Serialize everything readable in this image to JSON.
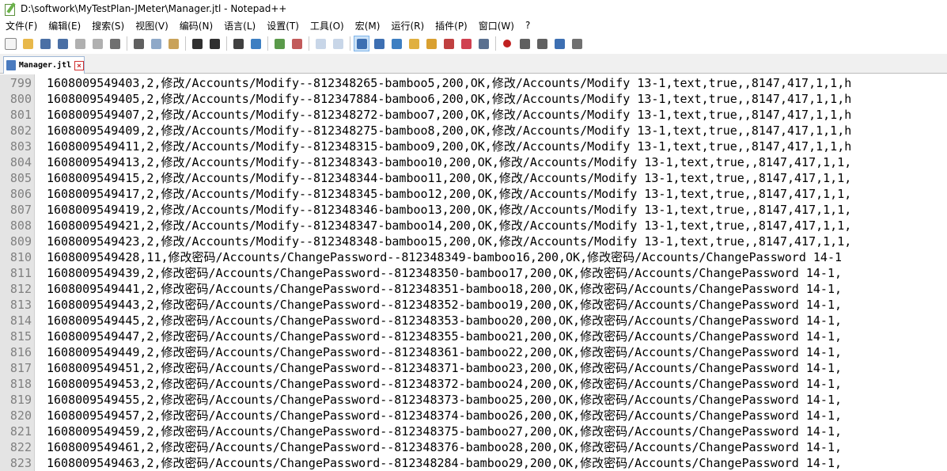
{
  "window": {
    "title": "D:\\softwork\\MyTestPlan-JMeter\\Manager.jtl - Notepad++"
  },
  "menu": [
    "文件(F)",
    "编辑(E)",
    "搜索(S)",
    "视图(V)",
    "编码(N)",
    "语言(L)",
    "设置(T)",
    "工具(O)",
    "宏(M)",
    "运行(R)",
    "插件(P)",
    "窗口(W)",
    "?"
  ],
  "toolbar": {
    "groups": [
      [
        "new-file-icon",
        "open-file-icon",
        "save-icon",
        "save-all-icon",
        "close-icon",
        "close-all-icon",
        "print-icon"
      ],
      [
        "cut-icon",
        "copy-icon",
        "paste-icon"
      ],
      [
        "undo-icon",
        "redo-icon"
      ],
      [
        "find-icon",
        "replace-icon"
      ],
      [
        "zoom-in-icon",
        "zoom-out-icon"
      ],
      [
        "sync-vertical-icon",
        "sync-horizontal-icon"
      ],
      [
        "word-wrap-icon",
        "show-all-chars-icon",
        "indent-guide-icon",
        "doc-map-icon",
        "function-list-icon",
        "folder-workspace-icon",
        "monitor-icon",
        "eye-icon"
      ],
      [
        "record-macro-icon",
        "stop-macro-icon",
        "play-macro-icon",
        "run-macro-multiple-icon",
        "save-macro-icon"
      ]
    ],
    "colors": {
      "new-file-icon": "#f4f4f4",
      "open-file-icon": "#e8b84a",
      "save-icon": "#4a6fa5",
      "save-all-icon": "#4a6fa5",
      "close-icon": "#b0b0b0",
      "close-all-icon": "#b0b0b0",
      "print-icon": "#707070",
      "cut-icon": "#606060",
      "copy-icon": "#8fa9c8",
      "paste-icon": "#c9a25a",
      "undo-icon": "#303030",
      "redo-icon": "#303030",
      "find-icon": "#404040",
      "replace-icon": "#3d7fc2",
      "zoom-in-icon": "#5a9a4a",
      "zoom-out-icon": "#c25a5a",
      "sync-vertical-icon": "#c8d6e8",
      "sync-horizontal-icon": "#c8d6e8",
      "word-wrap-icon": "#3d6fb2",
      "show-all-chars-icon": "#3d6fb2",
      "indent-guide-icon": "#3d7fc2",
      "doc-map-icon": "#e0b040",
      "function-list-icon": "#d9a030",
      "folder-workspace-icon": "#c04040",
      "monitor-icon": "#d04050",
      "eye-icon": "#5a7090",
      "record-macro-icon": "#c02020",
      "stop-macro-icon": "#606060",
      "play-macro-icon": "#606060",
      "run-macro-multiple-icon": "#3d6fb2",
      "save-macro-icon": "#707070"
    },
    "active": "word-wrap-icon"
  },
  "tab": {
    "label": "Manager.jtl"
  },
  "editor": {
    "lines": [
      {
        "n": "799",
        "t": "1608009549403,2,修改/Accounts/Modify--812348265-bamboo5,200,OK,修改/Accounts/Modify 13-1,text,true,,8147,417,1,1,h"
      },
      {
        "n": "800",
        "t": "1608009549405,2,修改/Accounts/Modify--812347884-bamboo6,200,OK,修改/Accounts/Modify 13-1,text,true,,8147,417,1,1,h"
      },
      {
        "n": "801",
        "t": "1608009549407,2,修改/Accounts/Modify--812348272-bamboo7,200,OK,修改/Accounts/Modify 13-1,text,true,,8147,417,1,1,h"
      },
      {
        "n": "802",
        "t": "1608009549409,2,修改/Accounts/Modify--812348275-bamboo8,200,OK,修改/Accounts/Modify 13-1,text,true,,8147,417,1,1,h"
      },
      {
        "n": "803",
        "t": "1608009549411,2,修改/Accounts/Modify--812348315-bamboo9,200,OK,修改/Accounts/Modify 13-1,text,true,,8147,417,1,1,h"
      },
      {
        "n": "804",
        "t": "1608009549413,2,修改/Accounts/Modify--812348343-bamboo10,200,OK,修改/Accounts/Modify 13-1,text,true,,8147,417,1,1,"
      },
      {
        "n": "805",
        "t": "1608009549415,2,修改/Accounts/Modify--812348344-bamboo11,200,OK,修改/Accounts/Modify 13-1,text,true,,8147,417,1,1,"
      },
      {
        "n": "806",
        "t": "1608009549417,2,修改/Accounts/Modify--812348345-bamboo12,200,OK,修改/Accounts/Modify 13-1,text,true,,8147,417,1,1,"
      },
      {
        "n": "807",
        "t": "1608009549419,2,修改/Accounts/Modify--812348346-bamboo13,200,OK,修改/Accounts/Modify 13-1,text,true,,8147,417,1,1,"
      },
      {
        "n": "808",
        "t": "1608009549421,2,修改/Accounts/Modify--812348347-bamboo14,200,OK,修改/Accounts/Modify 13-1,text,true,,8147,417,1,1,"
      },
      {
        "n": "809",
        "t": "1608009549423,2,修改/Accounts/Modify--812348348-bamboo15,200,OK,修改/Accounts/Modify 13-1,text,true,,8147,417,1,1,"
      },
      {
        "n": "810",
        "t": "1608009549428,11,修改密码/Accounts/ChangePassword--812348349-bamboo16,200,OK,修改密码/Accounts/ChangePassword 14-1"
      },
      {
        "n": "811",
        "t": "1608009549439,2,修改密码/Accounts/ChangePassword--812348350-bamboo17,200,OK,修改密码/Accounts/ChangePassword 14-1,"
      },
      {
        "n": "812",
        "t": "1608009549441,2,修改密码/Accounts/ChangePassword--812348351-bamboo18,200,OK,修改密码/Accounts/ChangePassword 14-1,"
      },
      {
        "n": "813",
        "t": "1608009549443,2,修改密码/Accounts/ChangePassword--812348352-bamboo19,200,OK,修改密码/Accounts/ChangePassword 14-1,"
      },
      {
        "n": "814",
        "t": "1608009549445,2,修改密码/Accounts/ChangePassword--812348353-bamboo20,200,OK,修改密码/Accounts/ChangePassword 14-1,"
      },
      {
        "n": "815",
        "t": "1608009549447,2,修改密码/Accounts/ChangePassword--812348355-bamboo21,200,OK,修改密码/Accounts/ChangePassword 14-1,"
      },
      {
        "n": "816",
        "t": "1608009549449,2,修改密码/Accounts/ChangePassword--812348361-bamboo22,200,OK,修改密码/Accounts/ChangePassword 14-1,"
      },
      {
        "n": "817",
        "t": "1608009549451,2,修改密码/Accounts/ChangePassword--812348371-bamboo23,200,OK,修改密码/Accounts/ChangePassword 14-1,"
      },
      {
        "n": "818",
        "t": "1608009549453,2,修改密码/Accounts/ChangePassword--812348372-bamboo24,200,OK,修改密码/Accounts/ChangePassword 14-1,"
      },
      {
        "n": "819",
        "t": "1608009549455,2,修改密码/Accounts/ChangePassword--812348373-bamboo25,200,OK,修改密码/Accounts/ChangePassword 14-1,"
      },
      {
        "n": "820",
        "t": "1608009549457,2,修改密码/Accounts/ChangePassword--812348374-bamboo26,200,OK,修改密码/Accounts/ChangePassword 14-1,"
      },
      {
        "n": "821",
        "t": "1608009549459,2,修改密码/Accounts/ChangePassword--812348375-bamboo27,200,OK,修改密码/Accounts/ChangePassword 14-1,"
      },
      {
        "n": "822",
        "t": "1608009549461,2,修改密码/Accounts/ChangePassword--812348376-bamboo28,200,OK,修改密码/Accounts/ChangePassword 14-1,"
      },
      {
        "n": "823",
        "t": "1608009549463,2,修改密码/Accounts/ChangePassword--812348284-bamboo29,200,OK,修改密码/Accounts/ChangePassword 14-1,"
      }
    ]
  }
}
